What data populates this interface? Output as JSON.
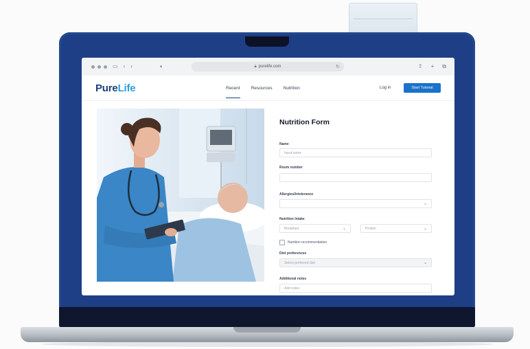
{
  "browser": {
    "url": "purelife.com"
  },
  "site": {
    "logo_main": "Pure",
    "logo_accent": "Life",
    "nav": [
      "Recent",
      "Resources",
      "Nutrition"
    ],
    "login": "Log in",
    "cta": "Start Tutorial"
  },
  "form": {
    "title": "Nutrition Form",
    "fields": [
      {
        "label": "Name",
        "placeholder": "Input name"
      },
      {
        "label": "Room number",
        "placeholder": ""
      },
      {
        "label": "Allergies/Intolerance",
        "placeholder": ""
      },
      {
        "label": "Nutrition Intake",
        "placeholder": "Breakfast"
      },
      {
        "label": "",
        "placeholder": "Protein"
      },
      {
        "label": "Diet preferences",
        "placeholder": "Select preferred diet"
      },
      {
        "label": "Additional notes",
        "placeholder": "Add notes"
      }
    ],
    "checkbox_label": "Nutrition recommendation"
  },
  "colors": {
    "brand": "#1c3f7a",
    "accent": "#2aa0dd",
    "cta": "#1a72c9",
    "scrubs": "#3a86c6",
    "lid": "#1e3f86"
  }
}
